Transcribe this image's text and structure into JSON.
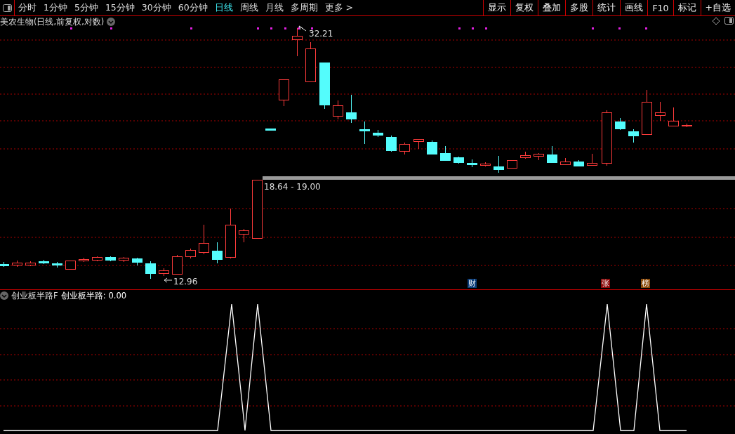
{
  "toolbar": {
    "periods": [
      {
        "label": "分时",
        "selected": false
      },
      {
        "label": "1分钟",
        "selected": false
      },
      {
        "label": "5分钟",
        "selected": false
      },
      {
        "label": "15分钟",
        "selected": false
      },
      {
        "label": "30分钟",
        "selected": false
      },
      {
        "label": "60分钟",
        "selected": false
      },
      {
        "label": "日线",
        "selected": true
      },
      {
        "label": "周线",
        "selected": false
      },
      {
        "label": "月线",
        "selected": false
      },
      {
        "label": "多周期",
        "selected": false
      },
      {
        "label": "更多 >",
        "selected": false
      }
    ],
    "buttons": [
      "显示",
      "复权",
      "叠加",
      "多股",
      "统计",
      "画线",
      "F10",
      "标记",
      "+自选"
    ]
  },
  "chart": {
    "title": "美农生物(日线,前复权,对数)",
    "high_label": "32.21",
    "low_label": "12.96",
    "band_label": "18.64 - 19.00",
    "badges": [
      {
        "label": "财",
        "color": "#0a3d7a"
      },
      {
        "label": "张",
        "color": "#8a0a0a"
      },
      {
        "label": "榜",
        "color": "#8a4a0a"
      }
    ]
  },
  "indicator": {
    "name": "创业板半路F",
    "series_label": "创业板半路:",
    "value": "0.00"
  }
}
